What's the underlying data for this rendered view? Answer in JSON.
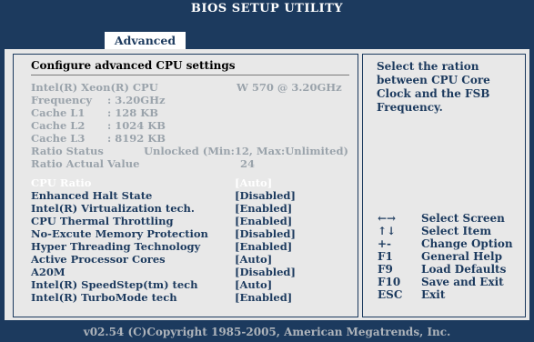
{
  "window": {
    "title": "BIOS SETUP UTILITY"
  },
  "tabs": [
    {
      "label": "Advanced"
    }
  ],
  "section": {
    "title": "Configure advanced CPU settings"
  },
  "info": [
    {
      "label": "Intel(R) Xeon(R) CPU",
      "value": "W 570 @ 3.20GHz"
    },
    {
      "label": "Frequency",
      "value": ": 3.20GHz"
    },
    {
      "label": "Cache L1",
      "value": ": 128 KB"
    },
    {
      "label": "Cache L2",
      "value": ": 1024 KB"
    },
    {
      "label": "Cache L3",
      "value": ": 8192 KB"
    },
    {
      "label": "Ratio Status",
      "value": "Unlocked (Min:12, Max:Unlimited)"
    },
    {
      "label": "Ratio Actual Value",
      "value": "24"
    }
  ],
  "settings": [
    {
      "label": "CPU Ratio",
      "value": "[Auto]",
      "selected": true
    },
    {
      "label": "Enhanced Halt State",
      "value": "[Disabled]"
    },
    {
      "label": "Intel(R) Virtualization tech.",
      "value": "[Enabled]"
    },
    {
      "label": "CPU Thermal Throttling",
      "value": "[Enabled]"
    },
    {
      "label": "No-Excute Memory Protection",
      "value": "[Disabled]"
    },
    {
      "label": "Hyper Threading Technology",
      "value": "[Enabled]"
    },
    {
      "label": "Active Processor Cores",
      "value": "[Auto]"
    },
    {
      "label": "A20M",
      "value": "[Disabled]"
    },
    {
      "label": "Intel(R) SpeedStep(tm) tech",
      "value": "[Auto]"
    },
    {
      "label": "Intel(R) TurboMode tech",
      "value": "[Enabled]"
    }
  ],
  "help": {
    "text": "Select the ration between CPU Core Clock and the FSB Frequency."
  },
  "keys": [
    {
      "key": "←→",
      "desc": "Select Screen",
      "icon": "left-right-arrows-icon"
    },
    {
      "key": "↑↓",
      "desc": "Select Item",
      "icon": "up-down-arrows-icon"
    },
    {
      "key": "+-",
      "desc": "Change Option"
    },
    {
      "key": "F1",
      "desc": "General Help"
    },
    {
      "key": "F9",
      "desc": "Load Defaults"
    },
    {
      "key": "F10",
      "desc": "Save and Exit"
    },
    {
      "key": "ESC",
      "desc": "Exit"
    }
  ],
  "footer": {
    "text": "v02.54 (C)Copyright 1985-2005, American Megatrends, Inc."
  },
  "colors": {
    "primary": "#1c3a5e",
    "panel": "#e8e8e8",
    "info_text": "#9aa3ab",
    "selected_text": "#ffffff"
  }
}
